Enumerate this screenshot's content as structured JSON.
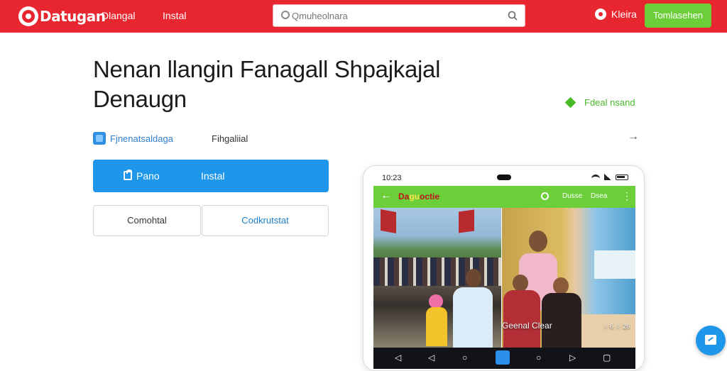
{
  "header": {
    "logo_text_main": "Datugan",
    "nav": [
      "Dlangal",
      "Instal"
    ],
    "search_placeholder": "Qmuheolnara",
    "user_label": "Kleira",
    "signup_label": "Tomlasehen"
  },
  "hero": {
    "title": "Nenan llangin Fanagall Shpajkajal Denaugn",
    "badge": "Fdeal nsand",
    "link_label": "Fjnenatsaldaga",
    "meta_label": "Fihgaliial",
    "arrow": "→",
    "install_left": "Pano",
    "install_right": "Instal",
    "secondary_1": "Comohtal",
    "secondary_2": "Codkrutstat"
  },
  "phone": {
    "time": "10:23",
    "app_title_a": "Da",
    "app_title_b": "gu",
    "app_title_c": "octie",
    "app_tab_1": "Dusse",
    "app_tab_2": "Dsea",
    "more": "⋮",
    "back": "←",
    "caption": "Geenal Clear",
    "rating": "○ 6 ☆ 26",
    "nav_icons": [
      "◁",
      "◁",
      "○",
      "○",
      "▷",
      "▢"
    ]
  },
  "colors": {
    "brand_red": "#e8262f",
    "accent_green": "#6ccf3a",
    "primary_blue": "#1e97ea"
  }
}
